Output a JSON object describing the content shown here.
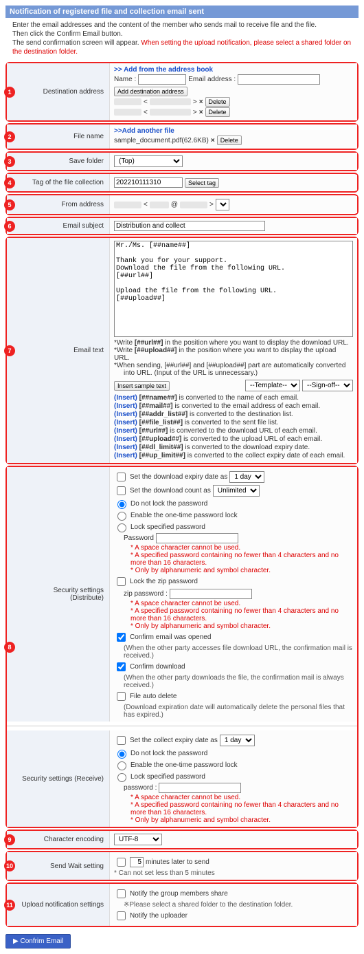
{
  "title": "Notification of registered file and collection email sent",
  "intro": {
    "l1": "Enter the email addresses and the content of the member who sends mail to receive file and the file.",
    "l2": "Then click the Confirm Email button.",
    "l3a": "The send confirmation screen will appear. ",
    "l3b": "When setting the upload notification, please select a shared folder on the destination folder."
  },
  "s1": {
    "label": "Destination address",
    "add_book": ">> Add from the address book",
    "name_lbl": "Name :",
    "email_lbl": "Email address :",
    "add_btn": "Add destination address",
    "delete_btn": "Delete"
  },
  "s2": {
    "label": "File name",
    "add_file": ">>Add another file",
    "file": "sample_document.pdf(62.6KB)",
    "delete_btn": "Delete"
  },
  "s3": {
    "label": "Save folder",
    "value": "(Top)"
  },
  "s4": {
    "label": "Tag of the file collection",
    "value": "202210111310",
    "select_btn": "Select tag"
  },
  "s5": {
    "label": "From address",
    "lt": "<",
    "at": "@",
    "gt": ">"
  },
  "s6": {
    "label": "Email subject",
    "value": "Distribution and collect"
  },
  "s7": {
    "label": "Email text",
    "body": "Mr./Ms. [##name##]\n\nThank you for your support.\nDownload the file from the following URL.\n[##url##]\n\nUpload the file from the following URL.\n[##upload##]",
    "hint1a": "*Write ",
    "hint1b": "[##url##]",
    "hint1c": " in the position where you want to display the download URL.",
    "hint2a": "*Write ",
    "hint2b": "[##upload##]",
    "hint2c": " in the position where you want to display the upload URL.",
    "hint3": "*When sending, [##url##] and [##upload##] part are automatically converted",
    "hint3b": "into URL. (Input of the URL is unnecessary.)",
    "insert_btn": "Insert sample text",
    "template_sel": "--Template--",
    "signoff_sel": "--Sign-off--",
    "ins": [
      {
        "k": "[##name##]",
        "v": " is converted to the name of each email."
      },
      {
        "k": "[##mail##]",
        "v": " is converted to the email address of each email."
      },
      {
        "k": "[##addr_list##]",
        "v": " is converted to the destination list."
      },
      {
        "k": "[##file_list##]",
        "v": " is converted to the sent file list."
      },
      {
        "k": "[##url##]",
        "v": " is converted to the download URL of each email."
      },
      {
        "k": "[##upload##]",
        "v": " is converted to the upload URL of each email."
      },
      {
        "k": "[##dl_limit##]",
        "v": " is converted to the download expiry date."
      },
      {
        "k": "[##up_limit##]",
        "v": " is converted to the collect expiry date of each email."
      }
    ],
    "insert_prefix": "(Insert) "
  },
  "s8": {
    "dist_label": "Security settings (Distribute)",
    "recv_label": "Security settings (Receive)",
    "dl_expiry": "Set the download expiry date as",
    "dl_count": "Set the download count as",
    "day_opt": "1 day",
    "unl_opt": "Unlimited",
    "no_lock": "Do not lock the password",
    "otp": "Enable the one-time password lock",
    "spec_pwd": "Lock specified password",
    "pwd_lbl": "Password",
    "pwd_lbl2": "password :",
    "zip_lock": "Lock the zip password",
    "zip_pwd": "zip password :",
    "rule1": "* A space character cannot be used.",
    "rule2": "* A specified password containing no fewer than 4 characters and no more than 16 characters.",
    "rule3": "* Only by alphanumeric and symbol character.",
    "conf_open": "Confirm email was opened",
    "conf_open_note": "(When the other party accesses file download URL, the confirmation mail is received.)",
    "conf_dl": "Confirm download",
    "conf_dl_note": "(When the other party downloads the file, the confirmation mail is always received.)",
    "auto_del": "File auto delete",
    "auto_del_note": "(Download expiration date will automatically delete the personal files that has expired.)",
    "col_expiry": "Set the collect expiry date as"
  },
  "s9": {
    "label": "Character encoding",
    "value": "UTF-8"
  },
  "s10": {
    "label": "Send Wait setting",
    "min5": "5",
    "suffix": "minutes later to send",
    "note": "* Can not set less than 5 minutes"
  },
  "s11": {
    "label": "Upload notification settings",
    "notify_group": "Notify the group members share",
    "group_note": "※Please select a shared folder to the destination folder.",
    "notify_uploader": "Notify the uploader"
  },
  "confirm_btn": "▶ Confrim Email"
}
